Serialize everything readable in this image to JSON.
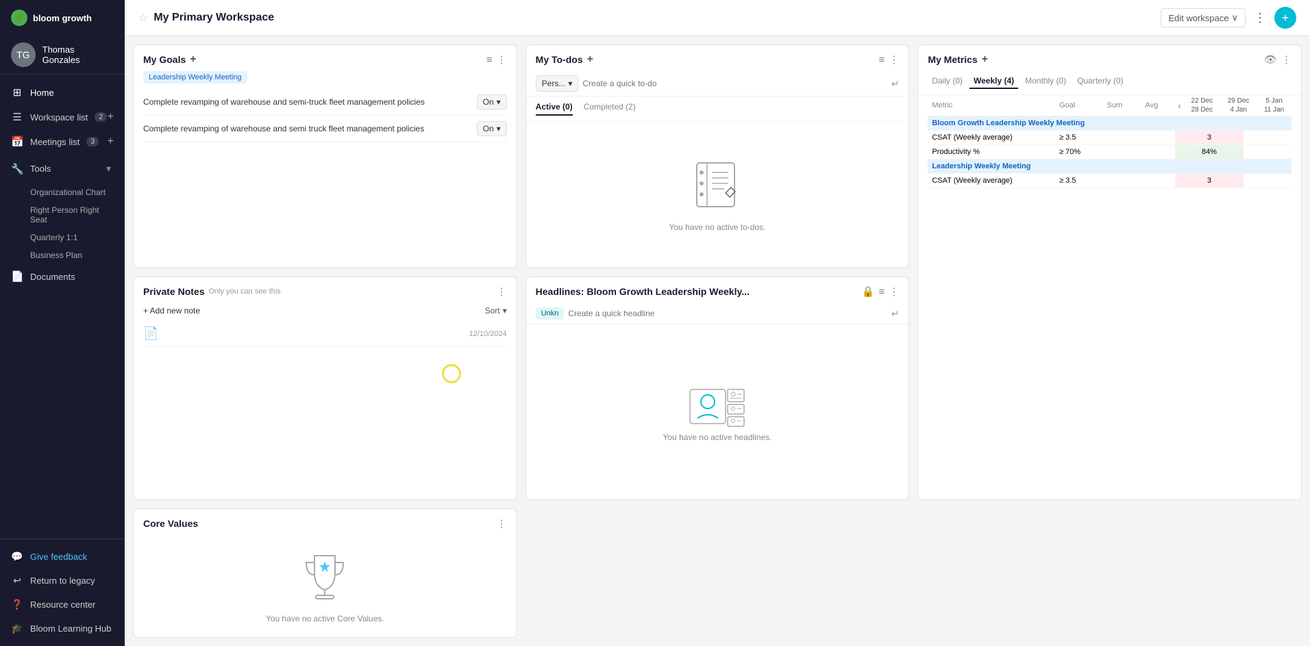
{
  "app": {
    "logo": "bloom growth",
    "logoIcon": "🌿"
  },
  "sidebar": {
    "user": {
      "name": "Thomas Gonzales",
      "initials": "TG"
    },
    "nav": [
      {
        "id": "home",
        "label": "Home",
        "icon": "⊞"
      },
      {
        "id": "workspace-list",
        "label": "Workspace list",
        "badge": "2",
        "icon": "☰",
        "hasAdd": true
      },
      {
        "id": "meetings-list",
        "label": "Meetings list",
        "badge": "3",
        "icon": "📅",
        "hasAdd": true
      },
      {
        "id": "tools",
        "label": "Tools",
        "icon": "🔧",
        "hasChevron": true
      },
      {
        "id": "documents",
        "label": "Documents",
        "icon": "📄"
      }
    ],
    "tools_sub": [
      "Organizational Chart",
      "Right Person Right Seat",
      "Quarterly 1:1",
      "Business Plan"
    ],
    "bottom": [
      {
        "id": "give-feedback",
        "label": "Give feedback",
        "icon": "💬",
        "highlight": true
      },
      {
        "id": "return-legacy",
        "label": "Return to legacy",
        "icon": "↩"
      },
      {
        "id": "resource-center",
        "label": "Resource center",
        "icon": "❓"
      },
      {
        "id": "bloom-learning-hub",
        "label": "Bloom Learning Hub",
        "icon": "🎓"
      }
    ]
  },
  "header": {
    "title": "My Primary Workspace",
    "edit_label": "Edit workspace",
    "chevron": "∨"
  },
  "goals": {
    "title": "My Goals",
    "tag": "Leadership Weekly Meeting",
    "items": [
      {
        "text": "Complete revamping of warehouse and semi-truck fleet management policies",
        "status": "On"
      },
      {
        "text": "Complete revamping of warehouse and semi truck fleet management policies",
        "status": "On"
      }
    ]
  },
  "todos": {
    "title": "My To-dos",
    "filter_label": "Pers...",
    "input_placeholder": "Create a quick to-do",
    "tabs": [
      {
        "id": "active",
        "label": "Active (0)",
        "active": true
      },
      {
        "id": "completed",
        "label": "Completed (2)",
        "active": false
      }
    ],
    "empty_text": "You have no active to-dos."
  },
  "private_notes": {
    "title": "Private Notes",
    "subtitle": "Only you can see this",
    "add_label": "+ Add new note",
    "sort_label": "Sort",
    "notes": [
      {
        "date": "12/10/2024"
      }
    ]
  },
  "headlines": {
    "title": "Headlines: Bloom Growth Leadership Weekly...",
    "person_chip": "Unkn",
    "input_placeholder": "Create a quick headline",
    "empty_text": "You have no active headlines."
  },
  "metrics": {
    "title": "My Metrics",
    "tabs": [
      {
        "label": "Daily (0)",
        "active": false
      },
      {
        "label": "Weekly (4)",
        "active": true
      },
      {
        "label": "Monthly (0)",
        "active": false
      },
      {
        "label": "Quarterly (0)",
        "active": false
      }
    ],
    "columns": {
      "metric": "Metric",
      "goal": "Goal",
      "sum": "Sum",
      "avg": "Avg",
      "dates": [
        {
          "range": "22 Dec\n28 Dec"
        },
        {
          "range": "29 Dec\n4 Jan"
        },
        {
          "range": "5 Jan\n11 Jan"
        }
      ]
    },
    "groups": [
      {
        "group_label": "Bloom Growth Leadership Weekly Meeting",
        "rows": [
          {
            "metric": "CSAT (Weekly average)",
            "goal": "≥ 3.5",
            "sum": "",
            "avg": "",
            "values": [
              "3",
              "",
              ""
            ],
            "highlight": [
              true,
              false,
              false
            ]
          },
          {
            "metric": "Productivity %",
            "goal": "≥ 70%",
            "sum": "",
            "avg": "",
            "values": [
              "84%",
              "",
              ""
            ],
            "highlight": [
              false,
              false,
              false
            ]
          }
        ]
      },
      {
        "group_label": "Leadership Weekly Meeting",
        "rows": [
          {
            "metric": "CSAT (Weekly average)",
            "goal": "≥ 3.5",
            "sum": "",
            "avg": "",
            "values": [
              "3",
              "",
              ""
            ],
            "highlight": [
              true,
              false,
              false
            ]
          }
        ]
      }
    ]
  },
  "core_values": {
    "title": "Core Values",
    "empty_text": "You have no active Core Values."
  }
}
